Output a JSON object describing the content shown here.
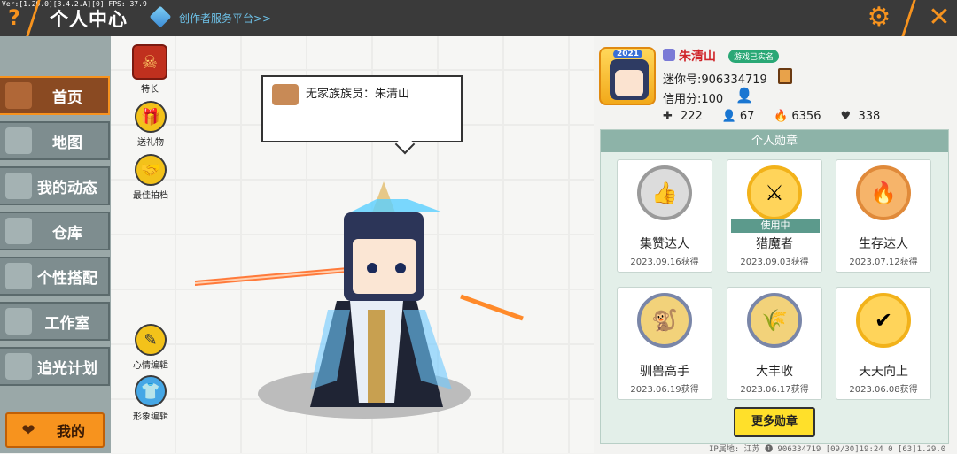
{
  "topbar": {
    "version": "Ver:[1.29.0][3.4.2.A][0] FPS: 37.9",
    "title": "个人中心",
    "creator_link": "创作者服务平台>>"
  },
  "sidebar": {
    "items": [
      {
        "label": "首页",
        "active": true,
        "icon": "home-icon"
      },
      {
        "label": "地图",
        "active": false,
        "icon": "map-icon"
      },
      {
        "label": "我的动态",
        "active": false,
        "icon": "bell-icon"
      },
      {
        "label": "仓库",
        "active": false,
        "icon": "warehouse-icon"
      },
      {
        "label": "个性搭配",
        "active": false,
        "icon": "outfit-icon"
      },
      {
        "label": "工作室",
        "active": false,
        "icon": "studio-icon"
      },
      {
        "label": "追光计划",
        "active": false,
        "icon": "light-icon"
      }
    ],
    "my_label": "我的"
  },
  "stage": {
    "specialty": "特长",
    "gift": "送礼物",
    "best_photo": "最佳拍档",
    "mood_edit": "心情编辑",
    "appearance_edit": "形象编辑",
    "bubble_text": "无家族族员：朱清山"
  },
  "profile": {
    "avatar_year": "2021",
    "username": "朱清山",
    "verified": "游戏已实名",
    "mini_id": "迷你号:906334719",
    "credit": "信用分:100",
    "stats": [
      "222",
      "67",
      "6356",
      "338"
    ]
  },
  "medals": {
    "header": "个人勋章",
    "in_use_label": "使用中",
    "items": [
      {
        "name": "集赞达人",
        "date": "2023.09.16获得",
        "color": "#9a9a9a"
      },
      {
        "name": "猎魔者",
        "date": "2023.09.03获得",
        "color": "#f2b21a",
        "in_use": true
      },
      {
        "name": "生存达人",
        "date": "2023.07.12获得",
        "color": "#e08a3a"
      },
      {
        "name": "驯兽高手",
        "date": "2023.06.19获得",
        "color": "#7a86a8"
      },
      {
        "name": "大丰收",
        "date": "2023.06.17获得",
        "color": "#7a86a8"
      },
      {
        "name": "天天向上",
        "date": "2023.06.08获得",
        "color": "#f2b21a"
      }
    ],
    "more_button": "更多勋章"
  },
  "footer": {
    "text": "IP属地: 江苏 ❶    906334719    [09/30]19:24 0    [63]1.29.0"
  }
}
